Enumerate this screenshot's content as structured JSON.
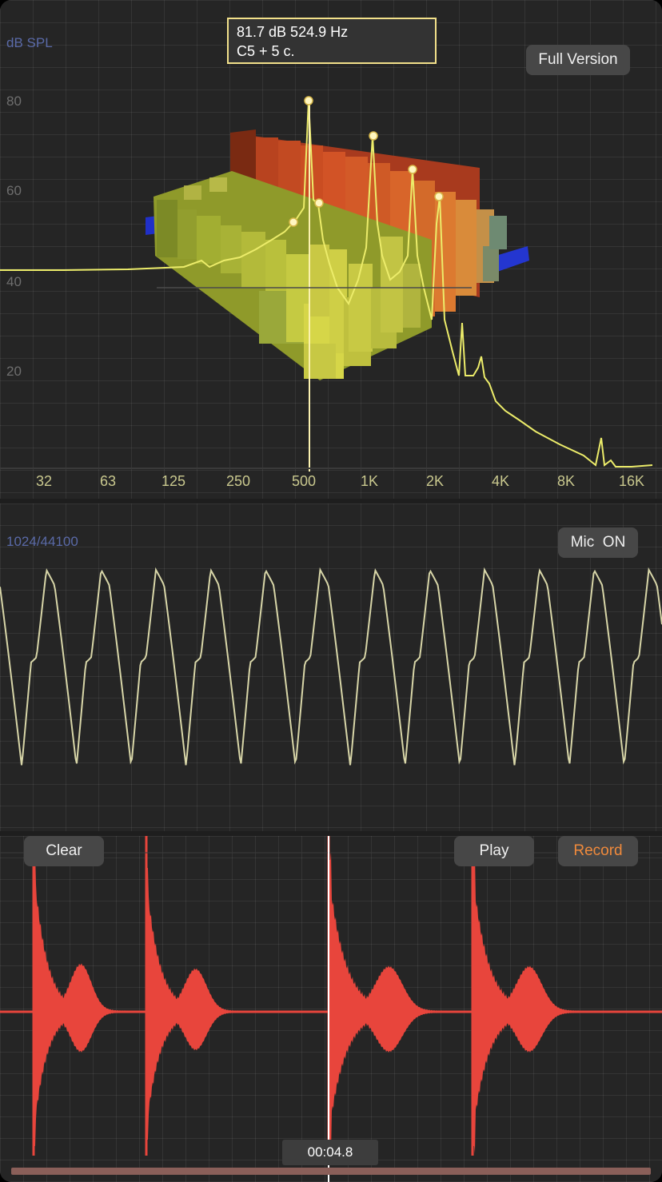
{
  "spectrum": {
    "unit_label": "dB SPL",
    "readout": {
      "line1": "81.7 dB 524.9 Hz",
      "line2": "C5 + 5 c."
    },
    "full_version_label": "Full Version",
    "y_ticks": [
      "80",
      "60",
      "40",
      "20"
    ],
    "x_ticks": [
      "32",
      "63",
      "125",
      "250",
      "500",
      "1K",
      "2K",
      "4K",
      "8K",
      "16K"
    ]
  },
  "oscilloscope": {
    "info_label": "1024/44100",
    "mic_label": "Mic  ON"
  },
  "recorder": {
    "clear_label": "Clear",
    "play_label": "Play",
    "record_label": "Record",
    "time": "00:04.8"
  },
  "colors": {
    "panel_bg": "#252525",
    "accent_yellow": "#f2e08a",
    "record_orange": "#f08a3c",
    "waveform_red": "#e8453c",
    "scope_trace": "#d8d6a8"
  }
}
